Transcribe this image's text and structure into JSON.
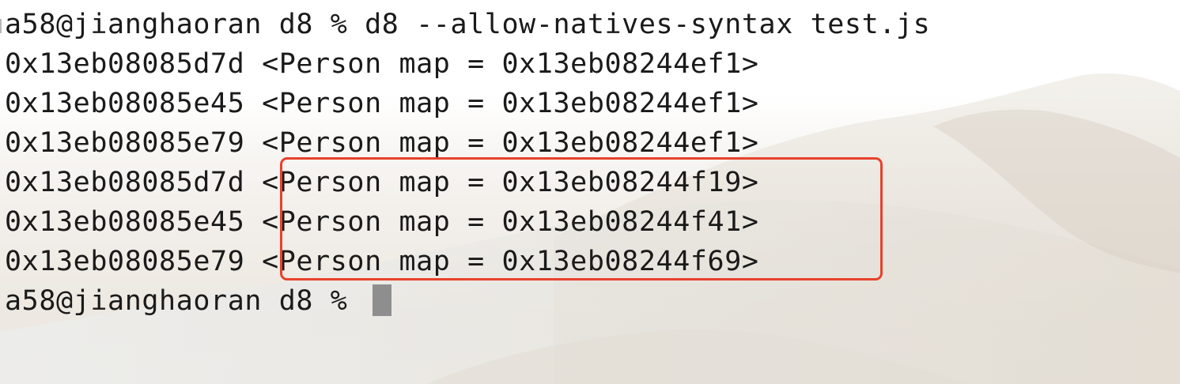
{
  "terminal": {
    "lines": [
      {
        "text": "a58@jianghaoran d8 % d8 --allow-natives-syntax test.js"
      },
      {
        "text": "0x13eb08085d7d <Person map = 0x13eb08244ef1>"
      },
      {
        "text": "0x13eb08085e45 <Person map = 0x13eb08244ef1>"
      },
      {
        "text": "0x13eb08085e79 <Person map = 0x13eb08244ef1>"
      },
      {
        "text": "0x13eb08085d7d <Person map = 0x13eb08244f19>"
      },
      {
        "text": "0x13eb08085e45 <Person map = 0x13eb08244f41>"
      },
      {
        "text": "0x13eb08085e79 <Person map = 0x13eb08244f69>"
      }
    ],
    "prompt": "a58@jianghaoran d8 % "
  },
  "colors": {
    "text": "#1a1a1a",
    "highlight_border": "#e8412c",
    "cursor": "#8e8e8e",
    "background": "#ffffff"
  }
}
